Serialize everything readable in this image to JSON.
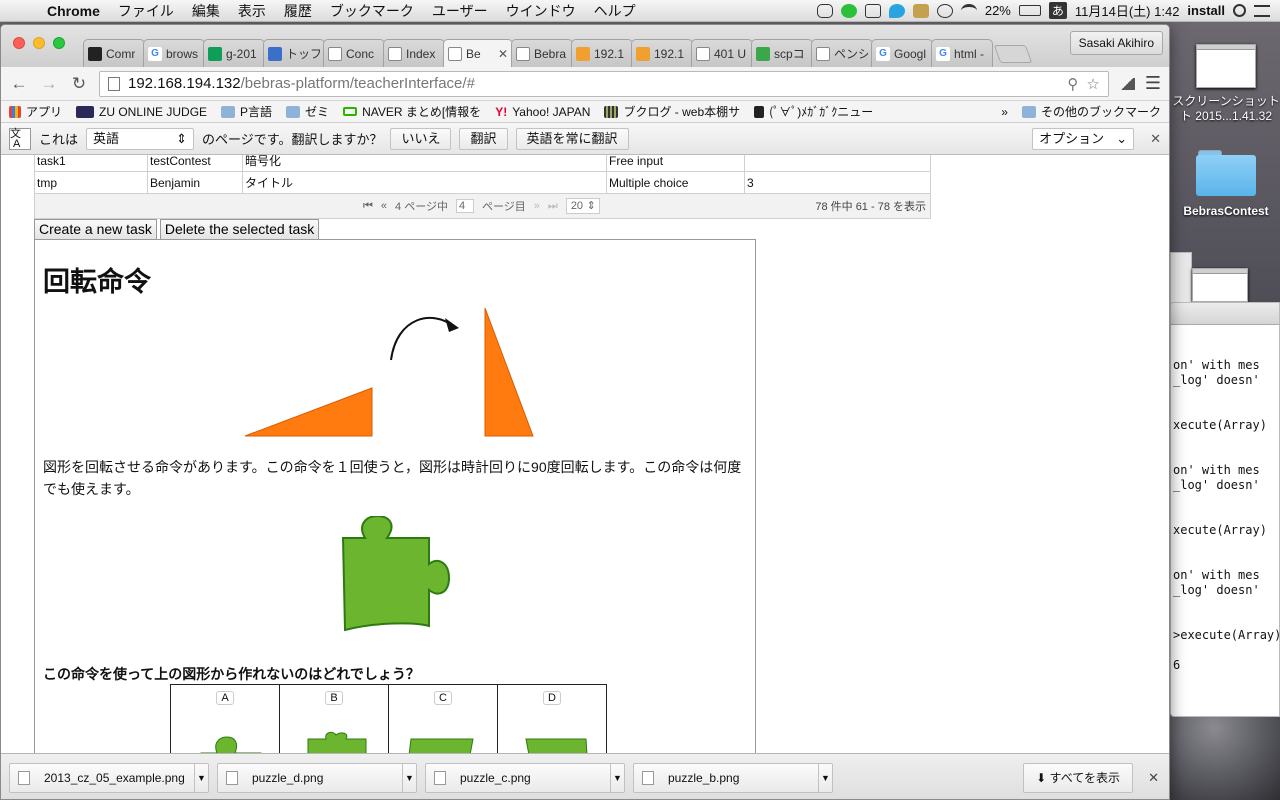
{
  "menubar": {
    "app": "Chrome",
    "items": [
      "ファイル",
      "編集",
      "表示",
      "履歴",
      "ブックマーク",
      "ユーザー",
      "ウインドウ",
      "ヘルプ"
    ],
    "battery": "22%",
    "clock": "11月14日(土)  1:42",
    "input_mode": "あ",
    "user": "install"
  },
  "desktop": {
    "screenshot_label_1": "スクリーンショット",
    "screenshot_label_2": "ト 2015...1.41.32",
    "folder_label": "BebrasContest"
  },
  "terminal": {
    "lines": [
      "on' with mes",
      "_log' doesn'",
      "xecute(Array)",
      "on' with mes",
      "_log' doesn'",
      "xecute(Array)",
      "on' with mes",
      "_log' doesn'",
      ">execute(Array)",
      "6"
    ]
  },
  "tabs": [
    {
      "label": "Comr",
      "icon": "github-icon",
      "active": false
    },
    {
      "label": "brows",
      "icon": "google-icon",
      "active": false
    },
    {
      "label": "g-201",
      "icon": "drive-icon",
      "active": false
    },
    {
      "label": "トッフ",
      "icon": "site-icon",
      "active": false
    },
    {
      "label": "Conc",
      "icon": "page-icon",
      "active": false
    },
    {
      "label": "Index",
      "icon": "page-icon",
      "active": false
    },
    {
      "label": "Be",
      "icon": "page-icon",
      "active": true
    },
    {
      "label": "Bebra",
      "icon": "page-icon",
      "active": false
    },
    {
      "label": "192.1",
      "icon": "pma-icon",
      "active": false
    },
    {
      "label": "192.1",
      "icon": "pma-icon",
      "active": false
    },
    {
      "label": "401 U",
      "icon": "page-icon",
      "active": false
    },
    {
      "label": "scpコ",
      "icon": "q-icon",
      "active": false
    },
    {
      "label": "ペンシ",
      "icon": "page-icon",
      "active": false
    },
    {
      "label": "Googl",
      "icon": "translate-icon",
      "active": false
    },
    {
      "label": "html -",
      "icon": "google-icon",
      "active": false
    }
  ],
  "profile_name": "Sasaki Akihiro",
  "address": {
    "host": "192.168.194.132",
    "path": "/bebras-platform/teacherInterface/#"
  },
  "bookmarks": [
    "アプリ",
    "ZU ONLINE JUDGE",
    "P言語",
    "ゼミ",
    "NAVER まとめ[情報を",
    "Yahoo! JAPAN",
    "ブクログ - web本棚サ",
    "(ﾟ∀ﾟ)ﾒｶﾞｶﾞｸニュー",
    "»",
    "その他のブックマーク"
  ],
  "translate": {
    "prefix": "これは",
    "language": "英語",
    "suffix": "のページです。翻訳しますか？",
    "no": "いいえ",
    "translate": "翻訳",
    "always": "英語を常に翻訳",
    "options": "オプション"
  },
  "table": {
    "rows": [
      {
        "name": "task1",
        "author": "testContest",
        "title": "暗号化",
        "type": "Free input",
        "answer": ""
      },
      {
        "name": "tmp",
        "author": "Benjamin",
        "title": "タイトル",
        "type": "Multiple choice",
        "answer": "3"
      }
    ]
  },
  "pager": {
    "page_prefix": "4 ページ中",
    "page": "4",
    "page_suffix": "ページ目",
    "rows_per_page": "20",
    "summary": "78 件中 61 - 78 を表示"
  },
  "buttons": {
    "create": "Create a new task",
    "delete": "Delete the selected task"
  },
  "task": {
    "title": "回転命令",
    "description": "図形を回転させる命令があります。この命令を１回使うと，図形は時計回りに90度回転します。この命令は何度でも使えます。",
    "question": "この命令を使って上の図形から作れないのはどれでしょう？",
    "choices": [
      "A",
      "B",
      "C",
      "D"
    ],
    "colors": {
      "orange": "#ff7a0f",
      "green": "#6cb52f"
    }
  },
  "downloads": {
    "files": [
      "2013_cz_05_example.png",
      "puzzle_d.png",
      "puzzle_c.png",
      "puzzle_b.png"
    ],
    "show_all": "すべてを表示"
  }
}
